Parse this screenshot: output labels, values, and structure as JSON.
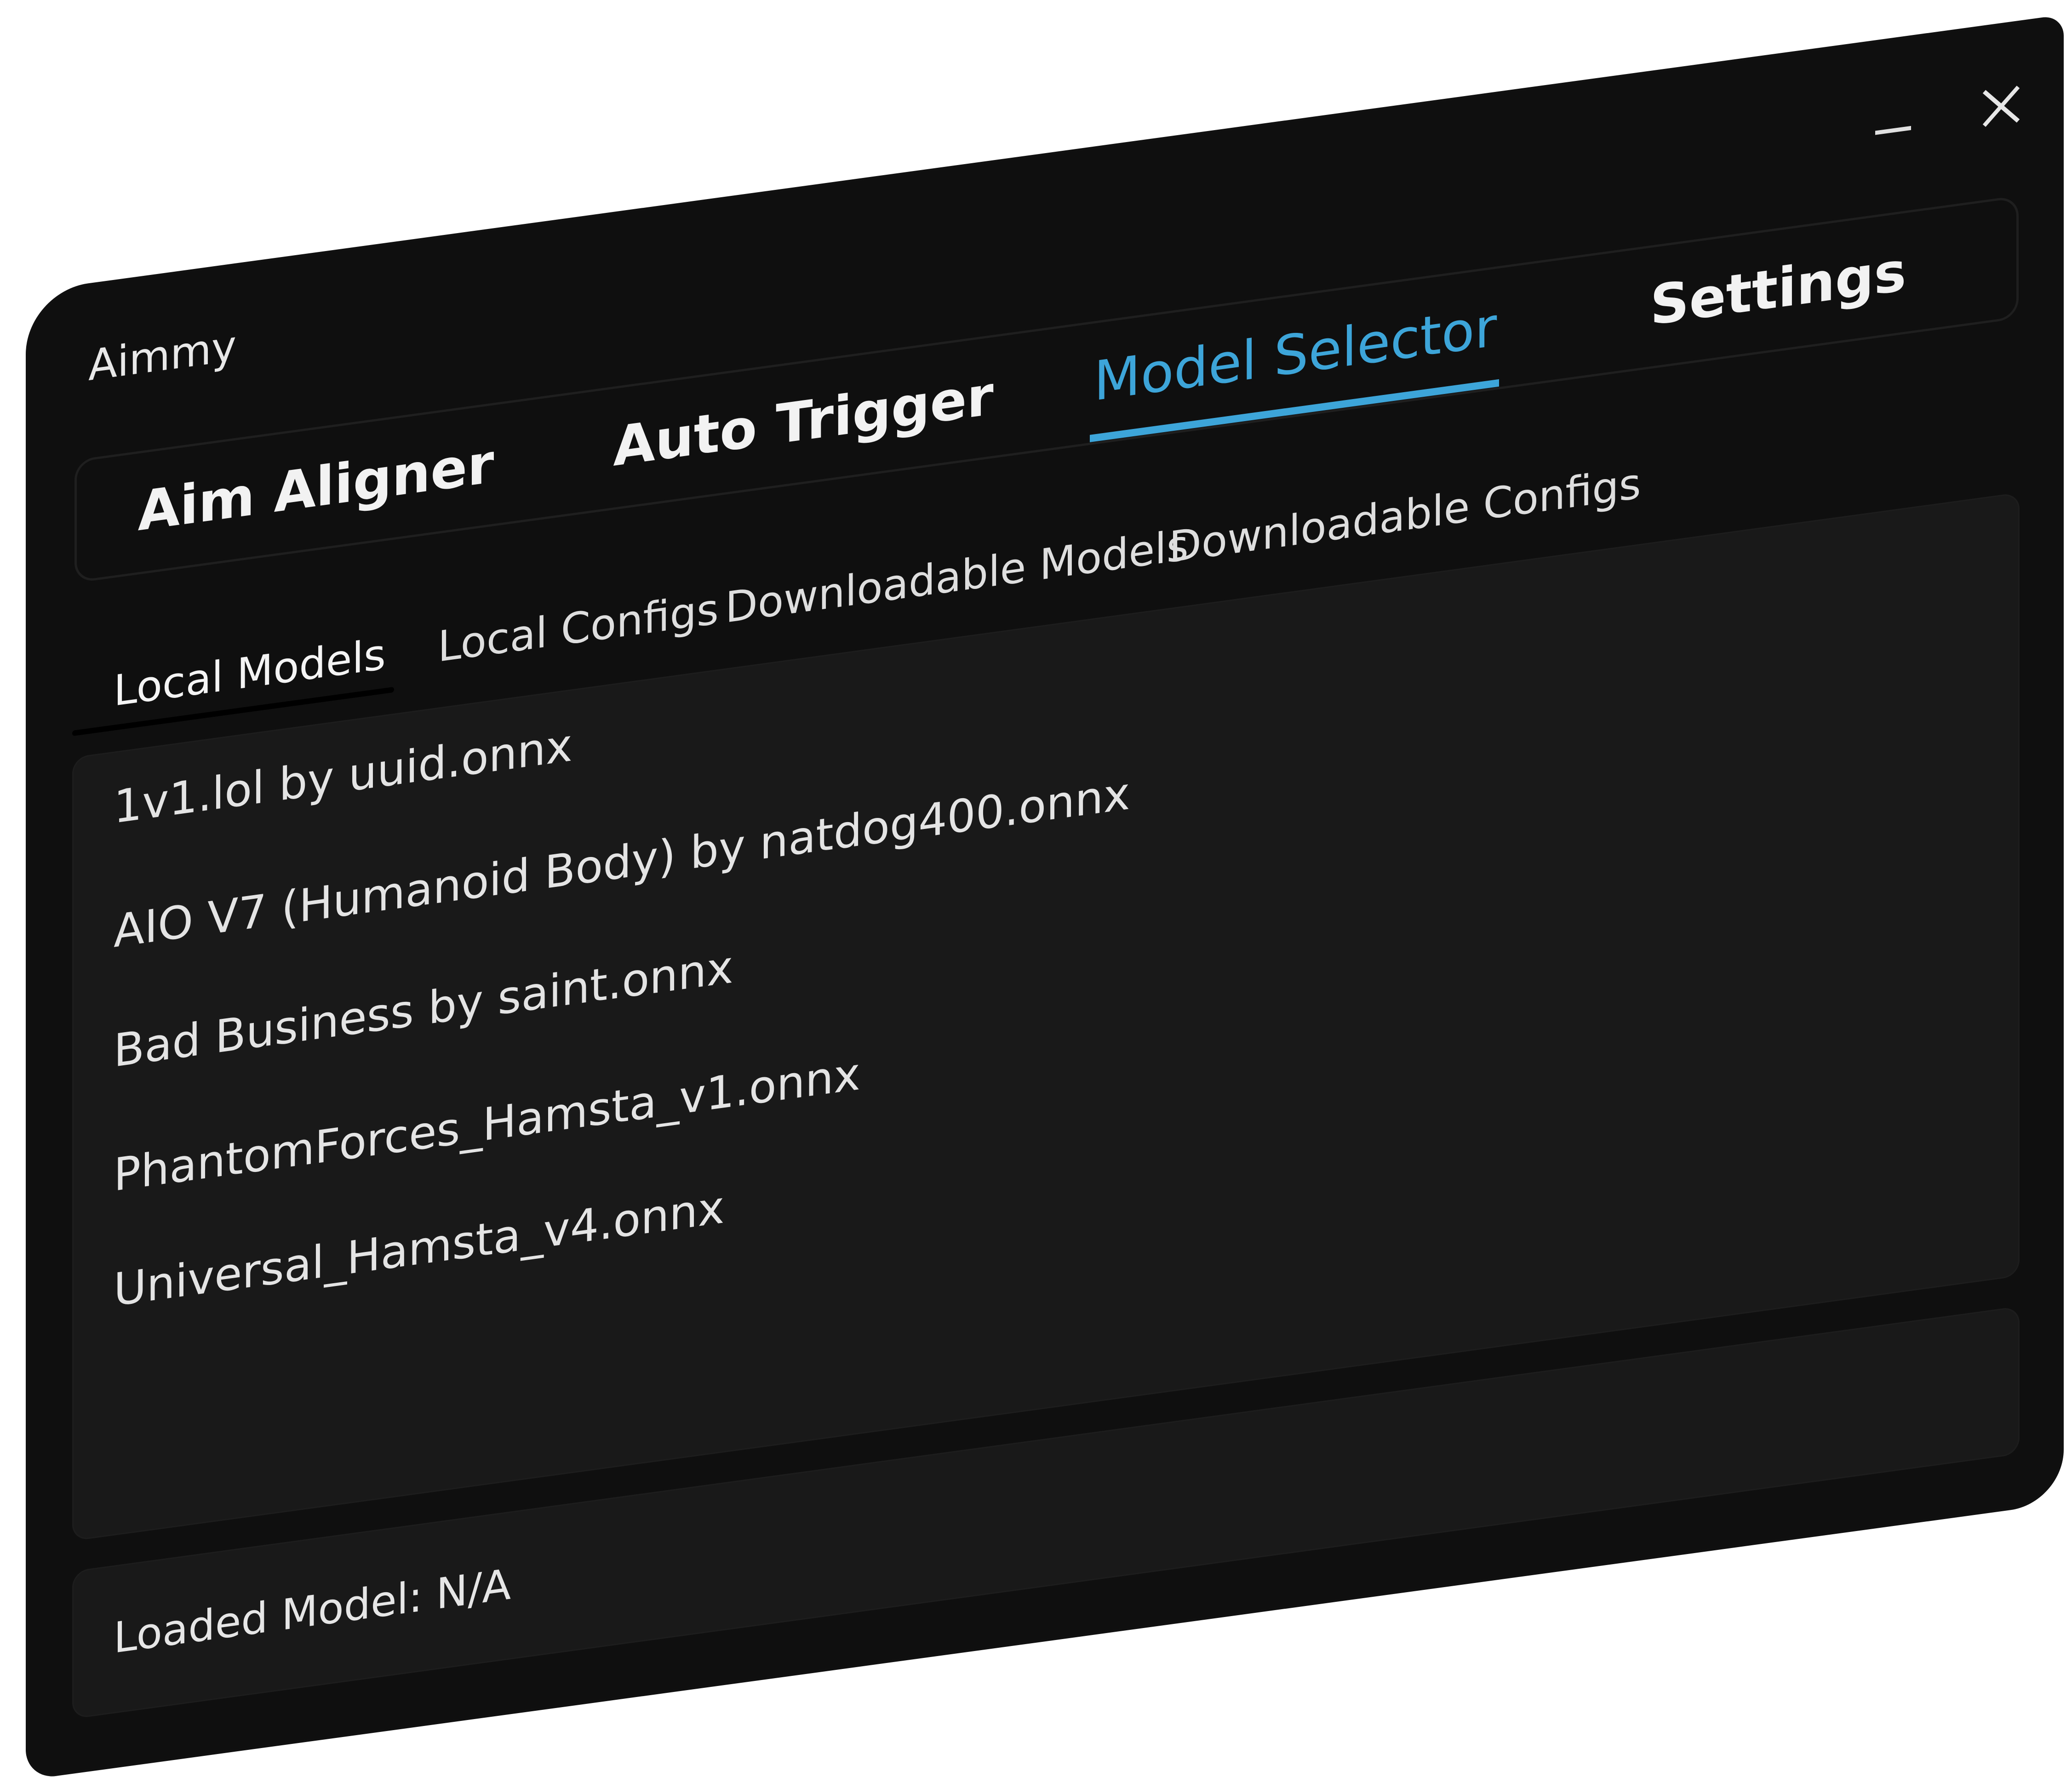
{
  "window": {
    "title": "Aimmy",
    "controls": {
      "minimize_icon": "minimize-icon",
      "close_icon": "close-icon"
    }
  },
  "main_tabs": [
    {
      "label": "Aim Aligner",
      "active": false
    },
    {
      "label": "Auto Trigger",
      "active": false
    },
    {
      "label": "Model Selector",
      "active": true
    },
    {
      "label": "Settings",
      "active": false
    }
  ],
  "sub_tabs": [
    {
      "label": "Local Models",
      "active": true
    },
    {
      "label": "Local Configs",
      "active": false
    },
    {
      "label": "Downloadable Models",
      "active": false
    },
    {
      "label": "Downloadable Configs",
      "active": false
    }
  ],
  "models": [
    "1v1.lol by uuid.onnx",
    "AIO V7 (Humanoid Body) by natdog400.onnx",
    "Bad Business by saint.onnx",
    "PhantomForces_Hamsta_v1.onnx",
    "Universal_Hamsta_v4.onnx"
  ],
  "status": {
    "loaded_model_text": "Loaded Model: N/A"
  },
  "colors": {
    "accent": "#3da5d9",
    "window_bg": "#0f0f0f",
    "panel_bg": "#191919",
    "text": "#e6e6e6"
  }
}
